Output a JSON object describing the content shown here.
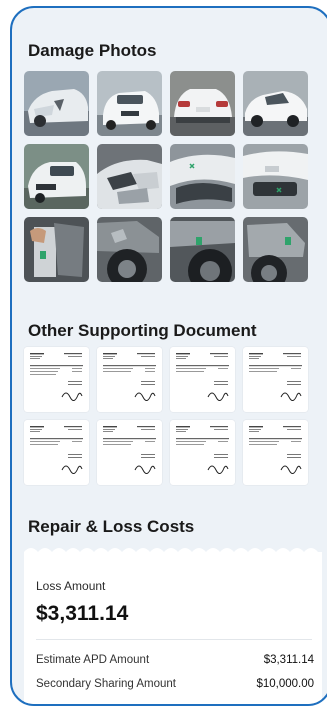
{
  "damage_photos": {
    "title": "Damage Photos",
    "photos": [
      {
        "icon": "car-front-damage-photo"
      },
      {
        "icon": "car-front-white-photo"
      },
      {
        "icon": "car-rear-white-photo"
      },
      {
        "icon": "car-side-white-photo"
      },
      {
        "icon": "car-front-left-photo"
      },
      {
        "icon": "car-headlight-damage-photo"
      },
      {
        "icon": "car-bumper-closeup-photo"
      },
      {
        "icon": "car-grille-closeup-photo"
      },
      {
        "icon": "engine-bay-photo"
      },
      {
        "icon": "wheel-well-photo"
      },
      {
        "icon": "tire-suspension-photo"
      },
      {
        "icon": "fender-frame-photo"
      }
    ]
  },
  "supporting_documents": {
    "title": "Other Supporting Document",
    "documents": [
      {
        "icon": "invoice-document-thumbnail"
      },
      {
        "icon": "invoice-document-thumbnail"
      },
      {
        "icon": "invoice-document-thumbnail"
      },
      {
        "icon": "invoice-document-thumbnail"
      },
      {
        "icon": "invoice-document-thumbnail"
      },
      {
        "icon": "invoice-document-thumbnail"
      },
      {
        "icon": "invoice-document-thumbnail"
      },
      {
        "icon": "invoice-document-thumbnail"
      }
    ]
  },
  "costs": {
    "title": "Repair & Loss Costs",
    "loss_label": "Loss Amount",
    "loss_amount": "$3,311.14",
    "rows": [
      {
        "label": "Estimate APD Amount",
        "value": "$3,311.14"
      },
      {
        "label": "Secondary Sharing Amount",
        "value": "$10,000.00"
      }
    ]
  },
  "colors": {
    "frame_border": "#1e6fbf",
    "panel_background": "#edf2f7",
    "card_background": "#ffffff"
  }
}
